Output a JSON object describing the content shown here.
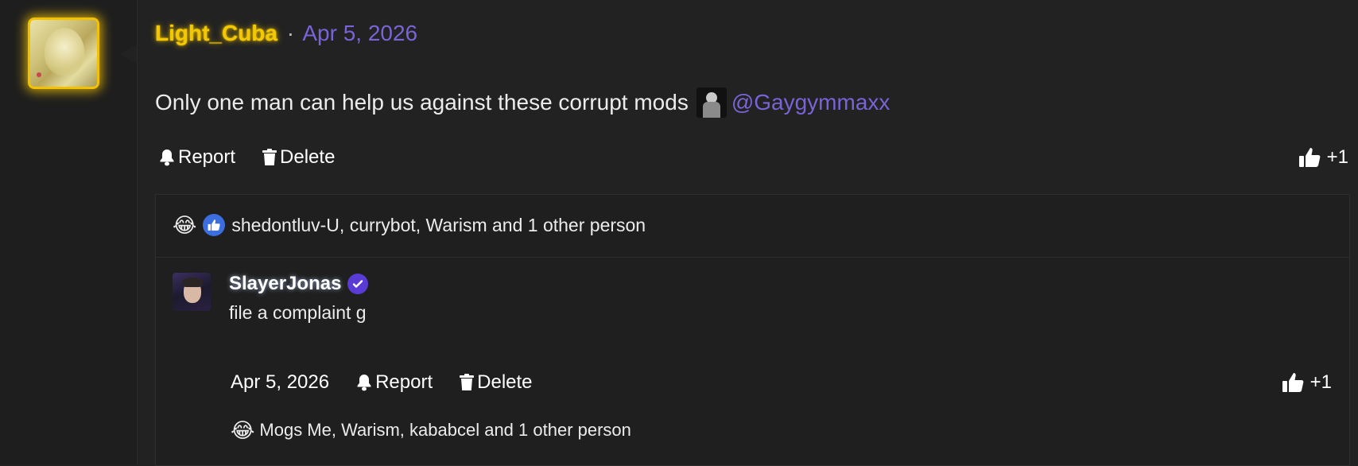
{
  "post": {
    "author": "Light_Cuba",
    "separator": "·",
    "date": "Apr 5, 2026",
    "text": "Only one man can help us against these corrupt mods",
    "mention": "@Gaygymmaxx",
    "actions": {
      "report": "Report",
      "delete": "Delete"
    },
    "like_count": "+1",
    "reactions": {
      "emojis": [
        "laughing-crying-emoji",
        "like-badge"
      ],
      "summary": "shedontluv-U, currybot, Warism and 1 other person"
    }
  },
  "reply": {
    "author": "SlayerJonas",
    "text": "file a complaint g",
    "date": "Apr 5, 2026",
    "actions": {
      "report": "Report",
      "delete": "Delete"
    },
    "like_count": "+1",
    "reactions": {
      "emojis": [
        "laughing-crying-emoji"
      ],
      "summary": "Mogs Me, Warism, kababcel and 1 other person"
    }
  },
  "colors": {
    "gold_name": "#f4c800",
    "link_purple": "#7a63d6",
    "verified": "#5b3bd6",
    "like_blue": "#3b6fe0",
    "background": "#222222"
  }
}
